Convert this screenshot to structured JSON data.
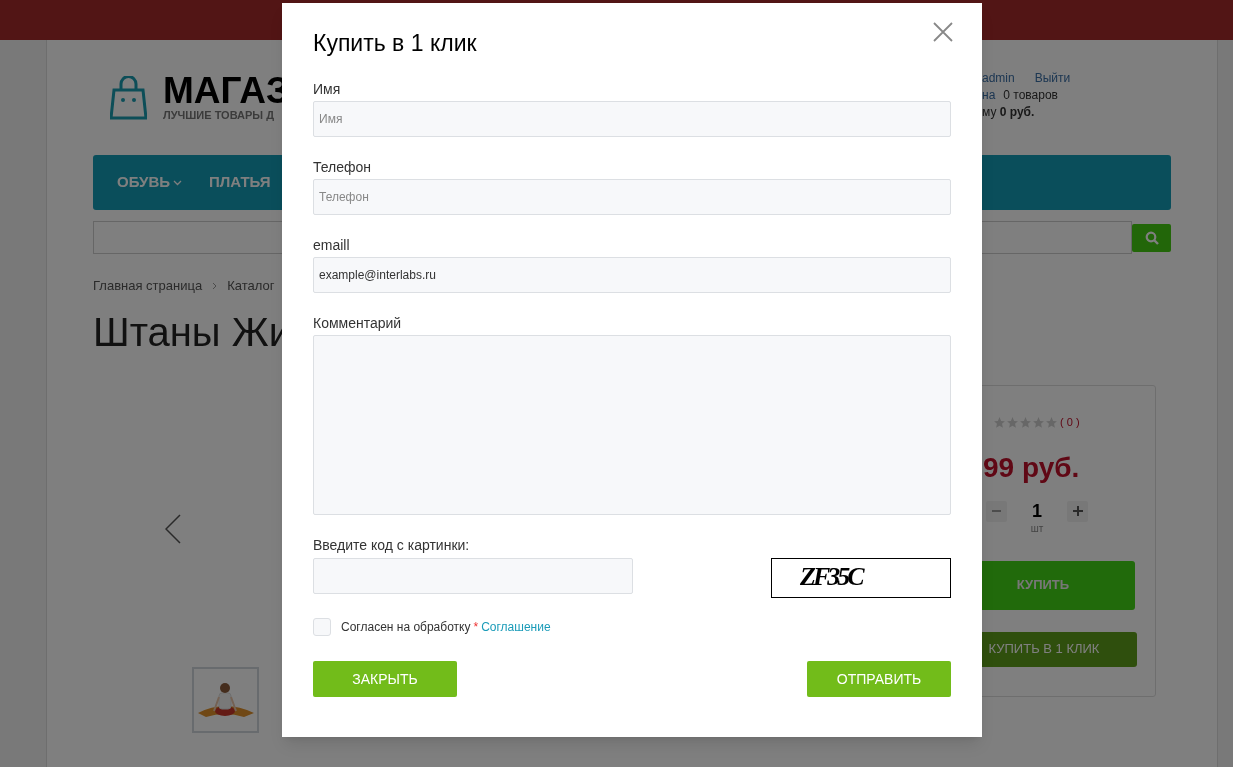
{
  "header": {
    "logo_text": "МАГАЗ",
    "logo_tagline": "ЛУЧШИЕ ТОВАРЫ Д",
    "user_links": [
      "admin",
      "Выйти"
    ],
    "cart": {
      "link": "на",
      "count": "0 товаров",
      "sum_prefix": "му",
      "sum": "0 руб."
    }
  },
  "nav": {
    "items": [
      {
        "label": "ОБУВЬ",
        "has_dropdown": true
      },
      {
        "label": "ПЛАТЬЯ",
        "has_dropdown": false
      }
    ]
  },
  "breadcrumb": [
    "Главная страница",
    "Каталог"
  ],
  "product": {
    "title": "Штаны Жи",
    "rating": {
      "stars": 0,
      "count": "( 0 )"
    },
    "price": "99 руб.",
    "quantity": "1",
    "unit": "шт",
    "buy_button": "КУПИТЬ",
    "one_click_button": "КУПИТЬ В 1 КЛИК"
  },
  "modal": {
    "title": "Купить в 1 клик",
    "fields": [
      {
        "kind": "input",
        "label": "Имя",
        "placeholder": "Имя"
      },
      {
        "kind": "input",
        "label": "Телефон",
        "placeholder": "Телефон"
      },
      {
        "kind": "input",
        "label": "emaill",
        "value": "example@interlabs.ru"
      },
      {
        "kind": "textarea",
        "label": "Комментарий"
      }
    ],
    "captcha": {
      "label": "Введите код с картинки:",
      "code": "ZF35C"
    },
    "consent": {
      "checked": false,
      "text": "Согласен на обработку",
      "required_mark": "*",
      "link": "Соглашение"
    },
    "buttons": [
      {
        "label": "ЗАКРЫТЬ"
      },
      {
        "label": "ОТПРАВИТЬ"
      }
    ]
  }
}
